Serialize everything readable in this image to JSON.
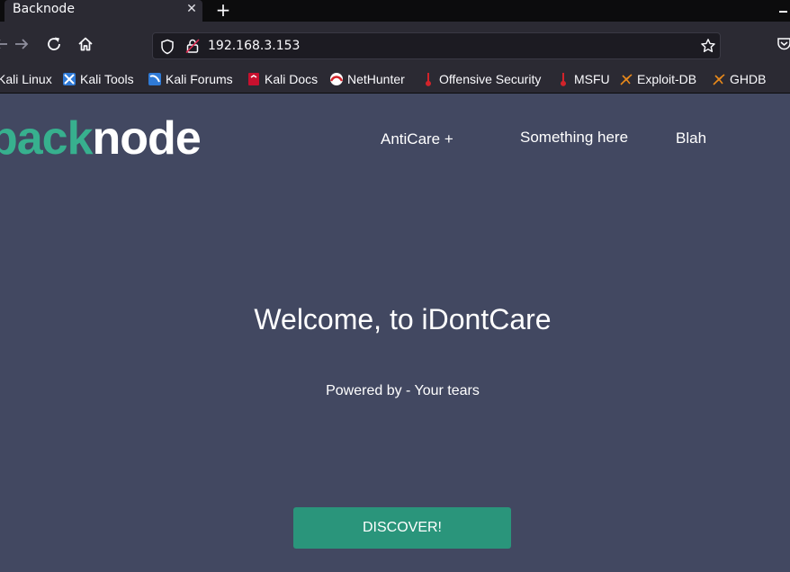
{
  "browser": {
    "tab": {
      "title": "Backnode",
      "close_glyph": "✕"
    },
    "new_tab_glyph": "+",
    "address": {
      "url": "192.168.3.153"
    },
    "icons": [
      "back-arrow-icon",
      "forward-arrow-icon",
      "reload-icon",
      "home-icon",
      "shield-icon",
      "lock-icon",
      "star-icon",
      "pocket-icon"
    ],
    "bookmarks": [
      {
        "label": "Kali Linux",
        "icon": "kali-icon"
      },
      {
        "label": "Kali Tools",
        "icon": "kali-tools-icon"
      },
      {
        "label": "Kali Forums",
        "icon": "kali-forums-icon"
      },
      {
        "label": "Kali Docs",
        "icon": "kali-docs-icon"
      },
      {
        "label": "NetHunter",
        "icon": "nethunter-icon"
      },
      {
        "label": "Offensive Security",
        "icon": "offsec-icon"
      },
      {
        "label": "MSFU",
        "icon": "msfu-icon"
      },
      {
        "label": "Exploit-DB",
        "icon": "exploitdb-icon"
      },
      {
        "label": "GHDB",
        "icon": "ghdb-icon"
      }
    ]
  },
  "site": {
    "logo": {
      "part1": "back",
      "part2": "node"
    },
    "nav": [
      {
        "label": "AntiCare +"
      },
      {
        "label": "Something here"
      },
      {
        "label": "Blah"
      }
    ],
    "hero": {
      "title": "Welcome, to iDontCare",
      "subtitle": "Powered by - Your tears",
      "cta": "DISCOVER!"
    }
  },
  "colors": {
    "page_bg": "#424861",
    "brand_green": "#37b08e",
    "cta_bg": "#2a957b",
    "chrome_bg": "#2b2a33"
  }
}
